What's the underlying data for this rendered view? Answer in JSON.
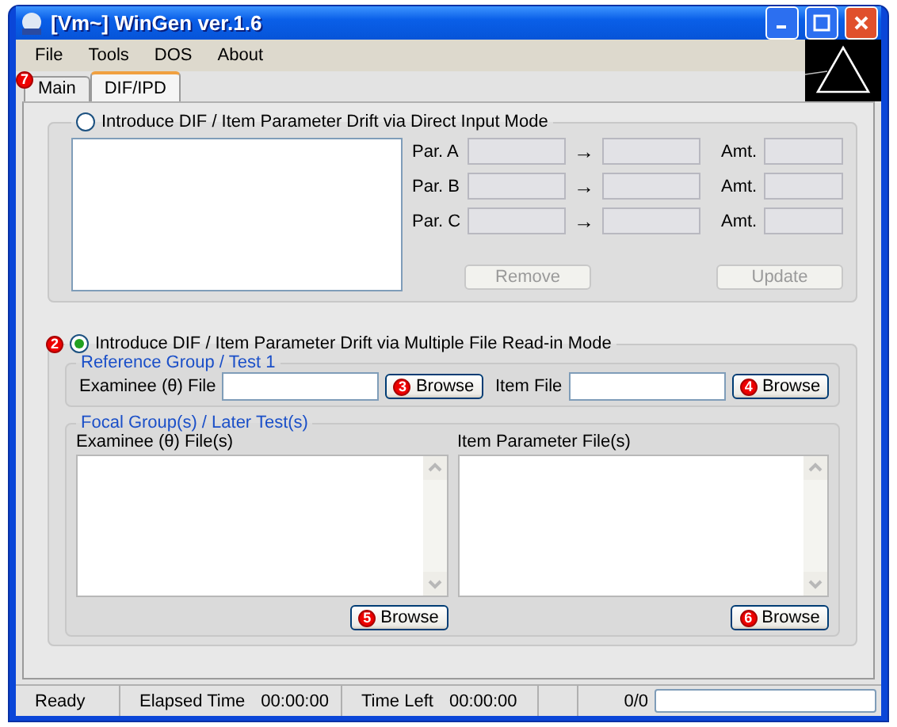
{
  "window": {
    "title": "[Vm~] WinGen ver.1.6"
  },
  "menu": [
    "File",
    "Tools",
    "DOS",
    "About"
  ],
  "tabs": [
    {
      "label": "Main",
      "selected": false,
      "badge": "7"
    },
    {
      "label": "DIF/IPD",
      "selected": true
    }
  ],
  "direct_input": {
    "label": "Introduce DIF / Item Parameter Drift via Direct Input Mode",
    "selected": false,
    "params": [
      {
        "label": "Par. A",
        "arrow": "→",
        "amount_label": "Amt."
      },
      {
        "label": "Par. B",
        "arrow": "→",
        "amount_label": "Amt."
      },
      {
        "label": "Par. C",
        "arrow": "→",
        "amount_label": "Amt."
      }
    ],
    "buttons": [
      {
        "label": "Remove",
        "disabled": true
      },
      {
        "label": "Update",
        "disabled": true
      }
    ]
  },
  "file_mode": {
    "badge": "2",
    "label": "Introduce DIF / Item Parameter Drift via Multiple File Read-in Mode",
    "selected": true,
    "reference": {
      "title": "Reference Group / Test 1",
      "examinee_label": "Examinee (θ) File",
      "examinee_button": {
        "label": "Browse",
        "badge": "3"
      },
      "item_label": "Item File",
      "item_button": {
        "label": "Browse",
        "badge": "4"
      }
    },
    "focal": {
      "title": "Focal Group(s) / Later Test(s)",
      "lists": [
        {
          "label": "Examinee (θ) File(s)",
          "button": {
            "label": "Browse",
            "badge": "5"
          }
        },
        {
          "label": "Item Parameter File(s)",
          "button": {
            "label": "Browse",
            "badge": "6"
          }
        }
      ]
    }
  },
  "status_bar": {
    "state": "Ready",
    "elapsed_label": "Elapsed Time",
    "elapsed": "00:00:00",
    "left_label": "Time Left",
    "left": "00:00:00",
    "count": "0/0",
    "progress": {
      "level": 0
    }
  }
}
